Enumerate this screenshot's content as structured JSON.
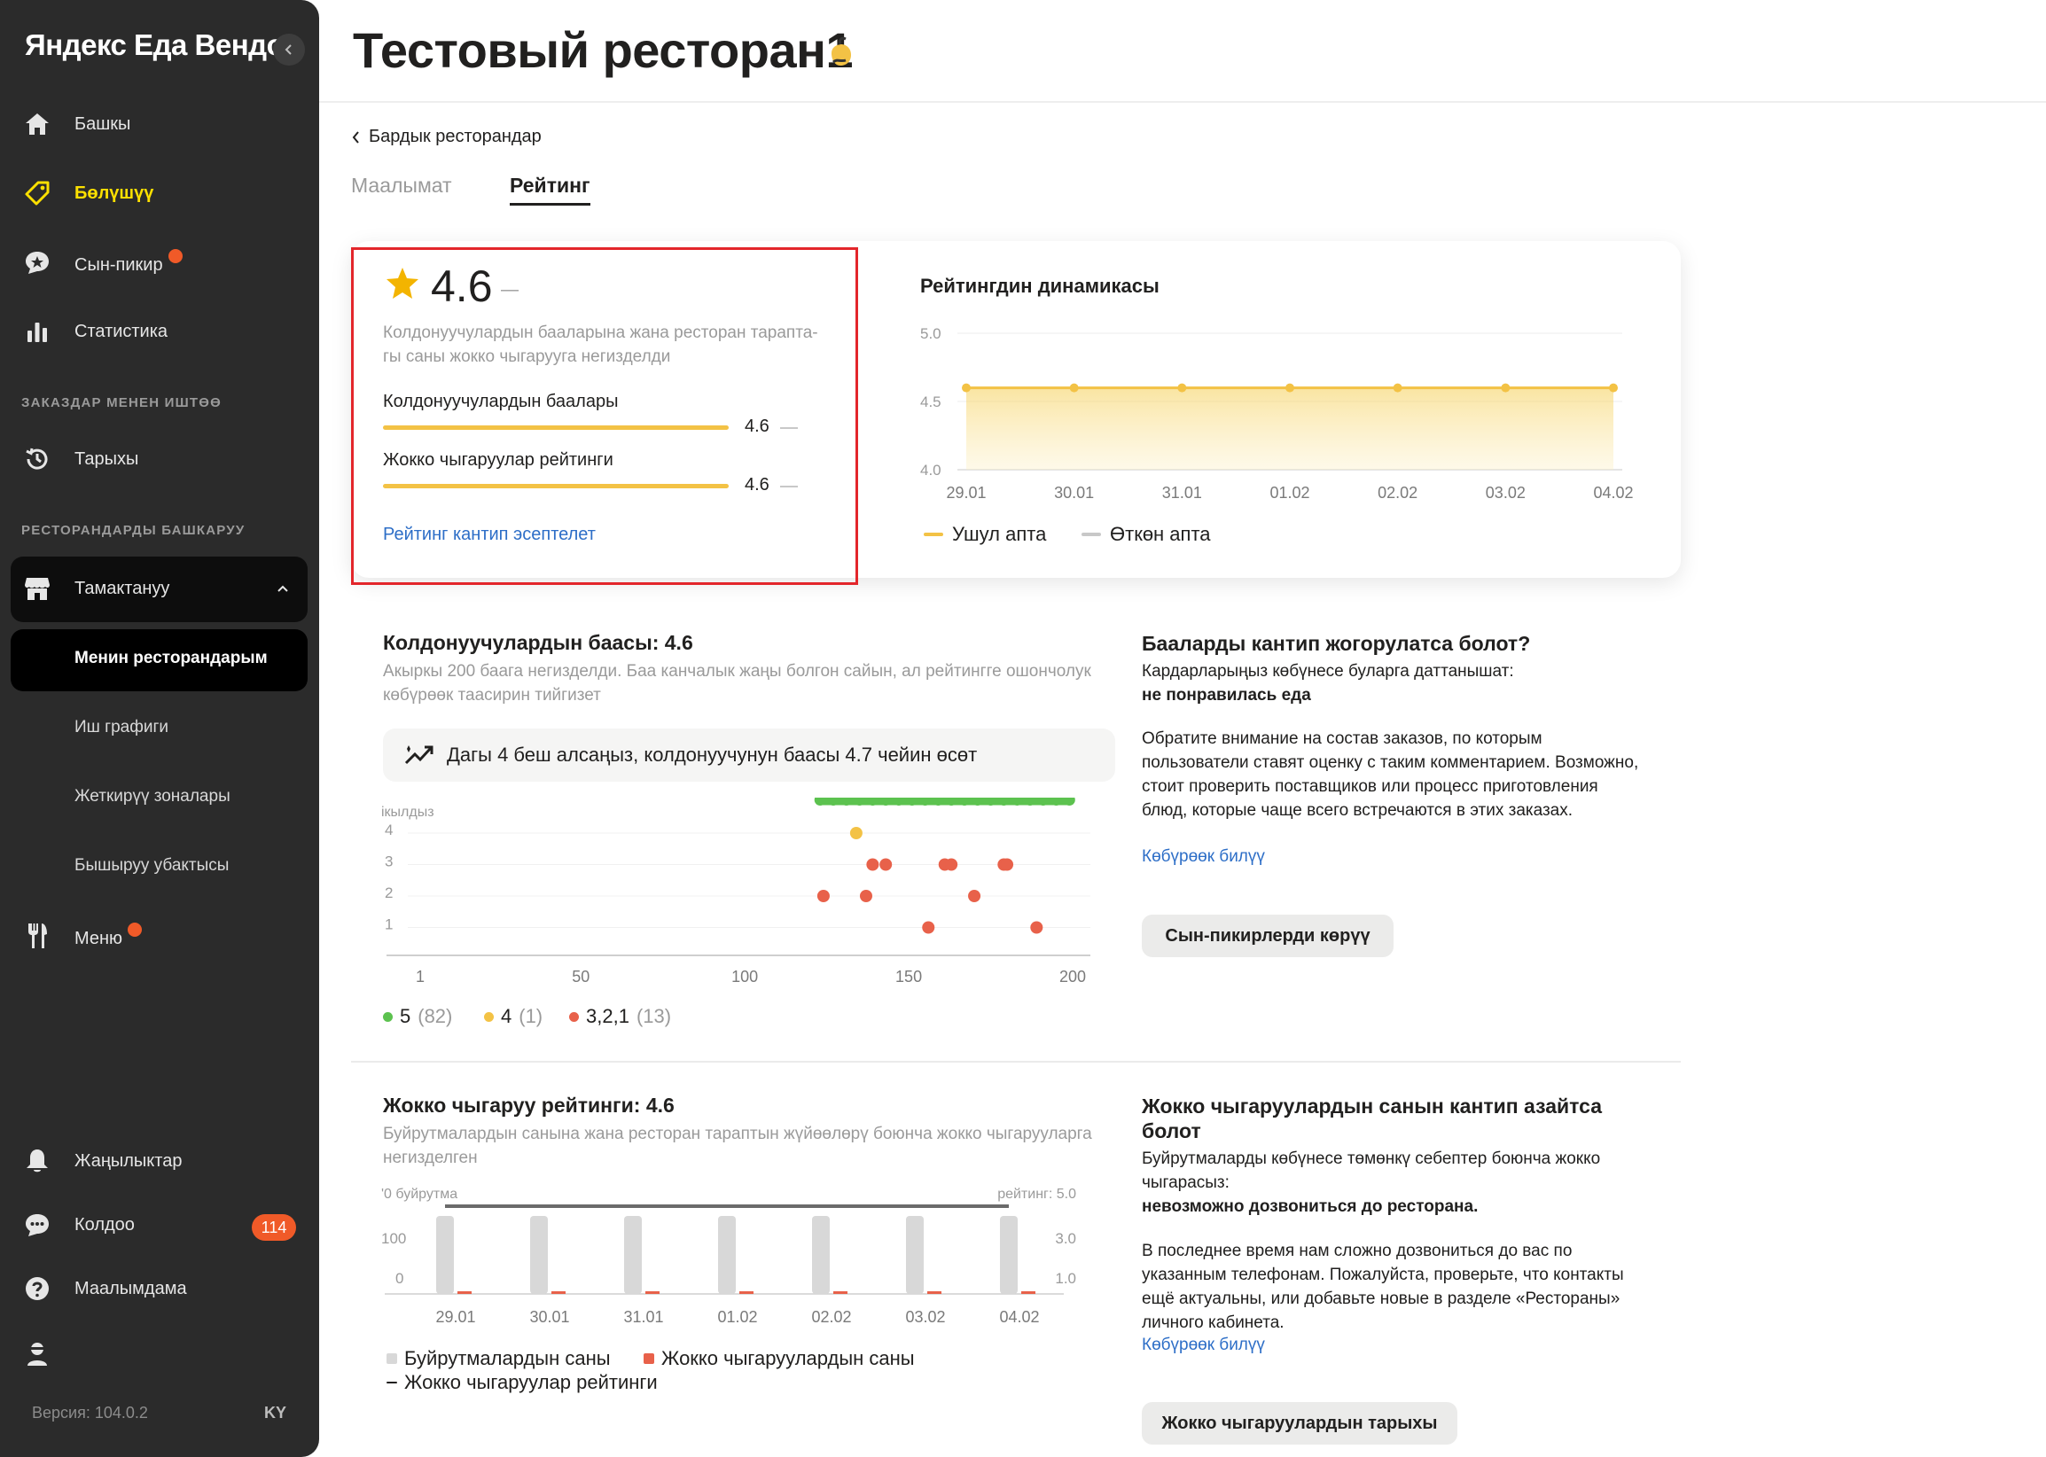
{
  "sidebar": {
    "brand": "Яндекс Еда Вендор",
    "items": [
      {
        "label": "Башкы",
        "icon": "home-icon"
      },
      {
        "label": "Бөлүшүү",
        "icon": "tag-icon"
      },
      {
        "label": "Сын-пикир",
        "icon": "review-icon"
      },
      {
        "label": "Статистика",
        "icon": "stats-icon"
      }
    ],
    "section_orders": "ЗАКАЗДАР МЕНЕН ИШТӨӨ",
    "history_label": "Тарыхы",
    "section_restaurants": "РЕСТОРАНДАРДЫ БАШКАРУУ",
    "group_label": "Тамактануу",
    "subitems": [
      "Менин ресторандарым",
      "Иш графиги",
      "Жеткирүү зоналары",
      "Бышыруу убактысы"
    ],
    "menu_label": "Меню",
    "news_label": "Жаңылыктар",
    "support_label": "Колдоо",
    "support_badge": "114",
    "help_label": "Маалымдама",
    "version": "Версия: 104.0.2",
    "lang": "KY",
    "colors": {
      "background": "#2b2b2b",
      "active": "#fce000",
      "badge": "#f05a28"
    }
  },
  "header": {
    "title": "Тестовый ресторан1",
    "back_link": "Бардык ресторандар",
    "tabs": [
      "Маалымат",
      "Рейтинг"
    ],
    "active_tab": "Рейтинг"
  },
  "rating_card": {
    "value": "4.6",
    "dash": "—",
    "description": "Колдонуучулардын бааларына жана ресторан тарапта­гы саны  жокко чыгарууга негизделди",
    "user_ratings_label": "Колдонуучулардын баалары",
    "user_ratings_value": "4.6",
    "cancel_rating_label": "Жокко чыгаруулар рейтинги",
    "cancel_rating_value": "4.6",
    "link": "Рейтинг кантип эсептелет"
  },
  "dynamics": {
    "title": "Рейтингдин динамикасы",
    "legend_this_week": "Ушул апта",
    "legend_last_week": "Өткөн апта"
  },
  "chart_data": [
    {
      "type": "area",
      "title": "Рейтингдин динамикасы",
      "categories": [
        "29.01",
        "30.01",
        "31.01",
        "01.02",
        "02.02",
        "03.02",
        "04.02"
      ],
      "y_ticks": [
        "5.0",
        "4.5",
        "4.0"
      ],
      "ylim": [
        4.0,
        5.0
      ],
      "series": [
        {
          "name": "Ушул апта",
          "values": [
            4.6,
            4.6,
            4.6,
            4.6,
            4.6,
            4.6,
            4.6
          ]
        }
      ],
      "legend": "bottom-left"
    },
    {
      "type": "scatter",
      "y_title_partial": "ікылдыз",
      "x_ticks": [
        "1",
        "50",
        "100",
        "150",
        "200"
      ],
      "y_ticks": [
        "4",
        "3",
        "2",
        "1"
      ],
      "xlim": [
        1,
        200
      ],
      "series": [
        {
          "name": "5",
          "count": "(82)",
          "color": "#5cc24f",
          "y": 5,
          "x": [
            123,
            127,
            131,
            135,
            139,
            143,
            147,
            151,
            155,
            159,
            163,
            167,
            171,
            175,
            179,
            183,
            187,
            191,
            195,
            199
          ]
        },
        {
          "name": "4",
          "count": "(1)",
          "color": "#f3c245",
          "y": 4,
          "x": [
            134
          ]
        },
        {
          "name": "3,2,1",
          "count": "(13)",
          "color": "#e8614a",
          "points": [
            [
              139,
              3
            ],
            [
              143,
              3
            ],
            [
              161,
              3
            ],
            [
              163,
              3
            ],
            [
              179,
              3
            ],
            [
              180,
              3
            ],
            [
              124,
              2
            ],
            [
              137,
              2
            ],
            [
              170,
              2
            ],
            [
              156,
              1
            ],
            [
              189,
              1
            ]
          ]
        }
      ]
    },
    {
      "type": "bar",
      "categories": [
        "29.01",
        "30.01",
        "31.01",
        "01.02",
        "02.02",
        "03.02",
        "04.02"
      ],
      "y_left_title_partial": "'0 буйрутма",
      "y_left_ticks": [
        "100",
        "0"
      ],
      "y_right_title": "рейтинг: 5.0",
      "y_right_ticks": [
        "3.0",
        "1.0"
      ],
      "series": [
        {
          "name": "Буйрутмалардын саны",
          "color": "#d8d8d8",
          "values": [
            100,
            100,
            100,
            100,
            100,
            100,
            100
          ]
        },
        {
          "name": "Жокко чыгаруулардын саны",
          "color": "#e8614a",
          "values": [
            0,
            0,
            0,
            0,
            0,
            0,
            0
          ]
        },
        {
          "name": "Жокко чыгаруулар рейтинги",
          "color": "#6b6b6b",
          "values": [
            4.6,
            4.6,
            4.6,
            4.6,
            4.6,
            4.6,
            4.6
          ]
        }
      ]
    }
  ],
  "user_score": {
    "title": "Колдонуучулардын баасы: 4.6",
    "description": "Акыркы 200 баага негизделди. Баа канчалык жаңы болгон сайын, ал рейтингге ошончолук көбүрөөк таасирин тийгизет",
    "tip": "Дагы 4 беш алсаңыз, колдонуучунун баасы 4.7 чейин өсөт",
    "legend": [
      {
        "label": "5",
        "count": "(82)"
      },
      {
        "label": "4",
        "count": "(1)"
      },
      {
        "label": "3,2,1",
        "count": "(13)"
      }
    ]
  },
  "improve": {
    "title": "Бааларды кантип жогорулатса болот?",
    "line1": "Кардарларыңыз көбүнесе буларга даттанышат:",
    "line2": "не понравилась еда",
    "body": "Обратите внимание на состав заказов, по которым пользователи ставят оценку с таким комментарием. Возможно, стоит проверить поставщиков или процесс приготовления блюд, которые чаще всего встречаются в этих заказах.",
    "link": "Көбүрөөк билүү",
    "button": "Сын-пикирлерди көрүү"
  },
  "cancel_section": {
    "title": "Жокко чыгаруу рейтинги: 4.6",
    "description": "Буйрутмалардын санына жана ресторан тараптын жүйөөлөрү боюнча жокко чыгарууларга негизделген",
    "legend_orders": "Буйрутмалардын саны",
    "legend_cancels": "Жокко чыгаруулардын саны",
    "legend_rating": "Жокко чыгаруулар рейтинги"
  },
  "reduce": {
    "title": "Жокко чыгаруулардын санын кантип азайтса болот",
    "line1": "Буйрутмаларды көбүнесе төмөнкү себептер боюнча жокко чыгарасыз:",
    "line2": "невозможно дозвониться до ресторана.",
    "body": "В последнее время нам сложно дозвониться до вас по указанным телефонам. Пожалуйста, проверьте, что контакты ещё актуальны, или добавьте новые в разделе «Рестораны» личного кабинета.",
    "link": "Көбүрөөк билүү",
    "button": "Жокко чыгаруулардын тарыхы"
  },
  "colors": {
    "accent": "#f3c245",
    "link": "#2d6ec7",
    "highlight": "#e3262b"
  }
}
